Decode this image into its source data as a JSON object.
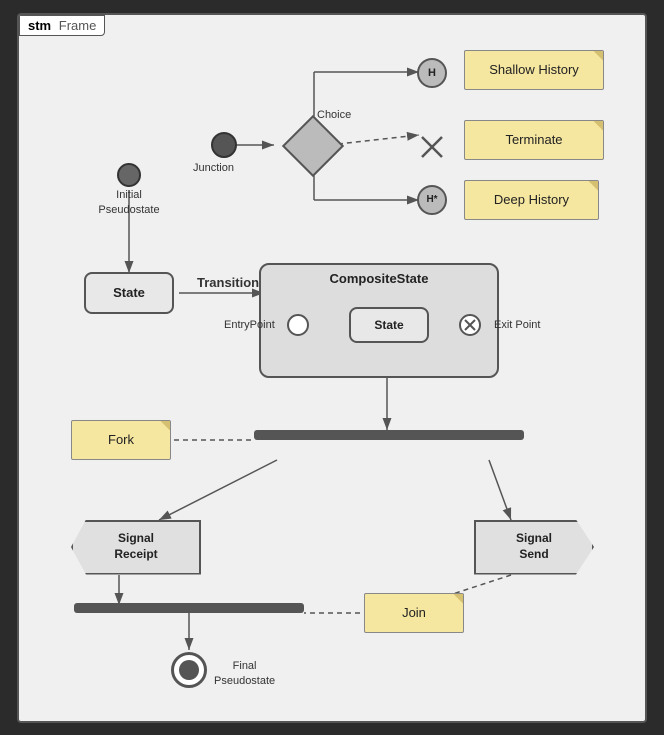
{
  "diagram": {
    "frame_keyword": "stm",
    "frame_name": "Frame",
    "nodes": {
      "initial_pseudostate": {
        "label": "Initial\nPseudostate"
      },
      "junction": {
        "label": "Junction"
      },
      "choice": {
        "label": "Choice"
      },
      "shallow_history": {
        "label": "H",
        "text": "Shallow History"
      },
      "terminate": {
        "label": "×",
        "text": "Terminate"
      },
      "deep_history": {
        "label": "H*",
        "text": "Deep History"
      },
      "state": {
        "label": "State"
      },
      "composite_state": {
        "label": "CompositeState"
      },
      "inner_state": {
        "label": "State"
      },
      "entry_point": {
        "label": "EntryPoint"
      },
      "exit_point": {
        "label": "Exit Point"
      },
      "fork": {
        "text": "Fork"
      },
      "signal_receipt": {
        "label": "Signal\nReceipt"
      },
      "signal_send": {
        "label": "Signal\nSend"
      },
      "join": {
        "text": "Join"
      },
      "final_pseudostate": {
        "label": "Final\nPseudostate"
      }
    },
    "transitions": {
      "transition_label": "Transition"
    }
  }
}
